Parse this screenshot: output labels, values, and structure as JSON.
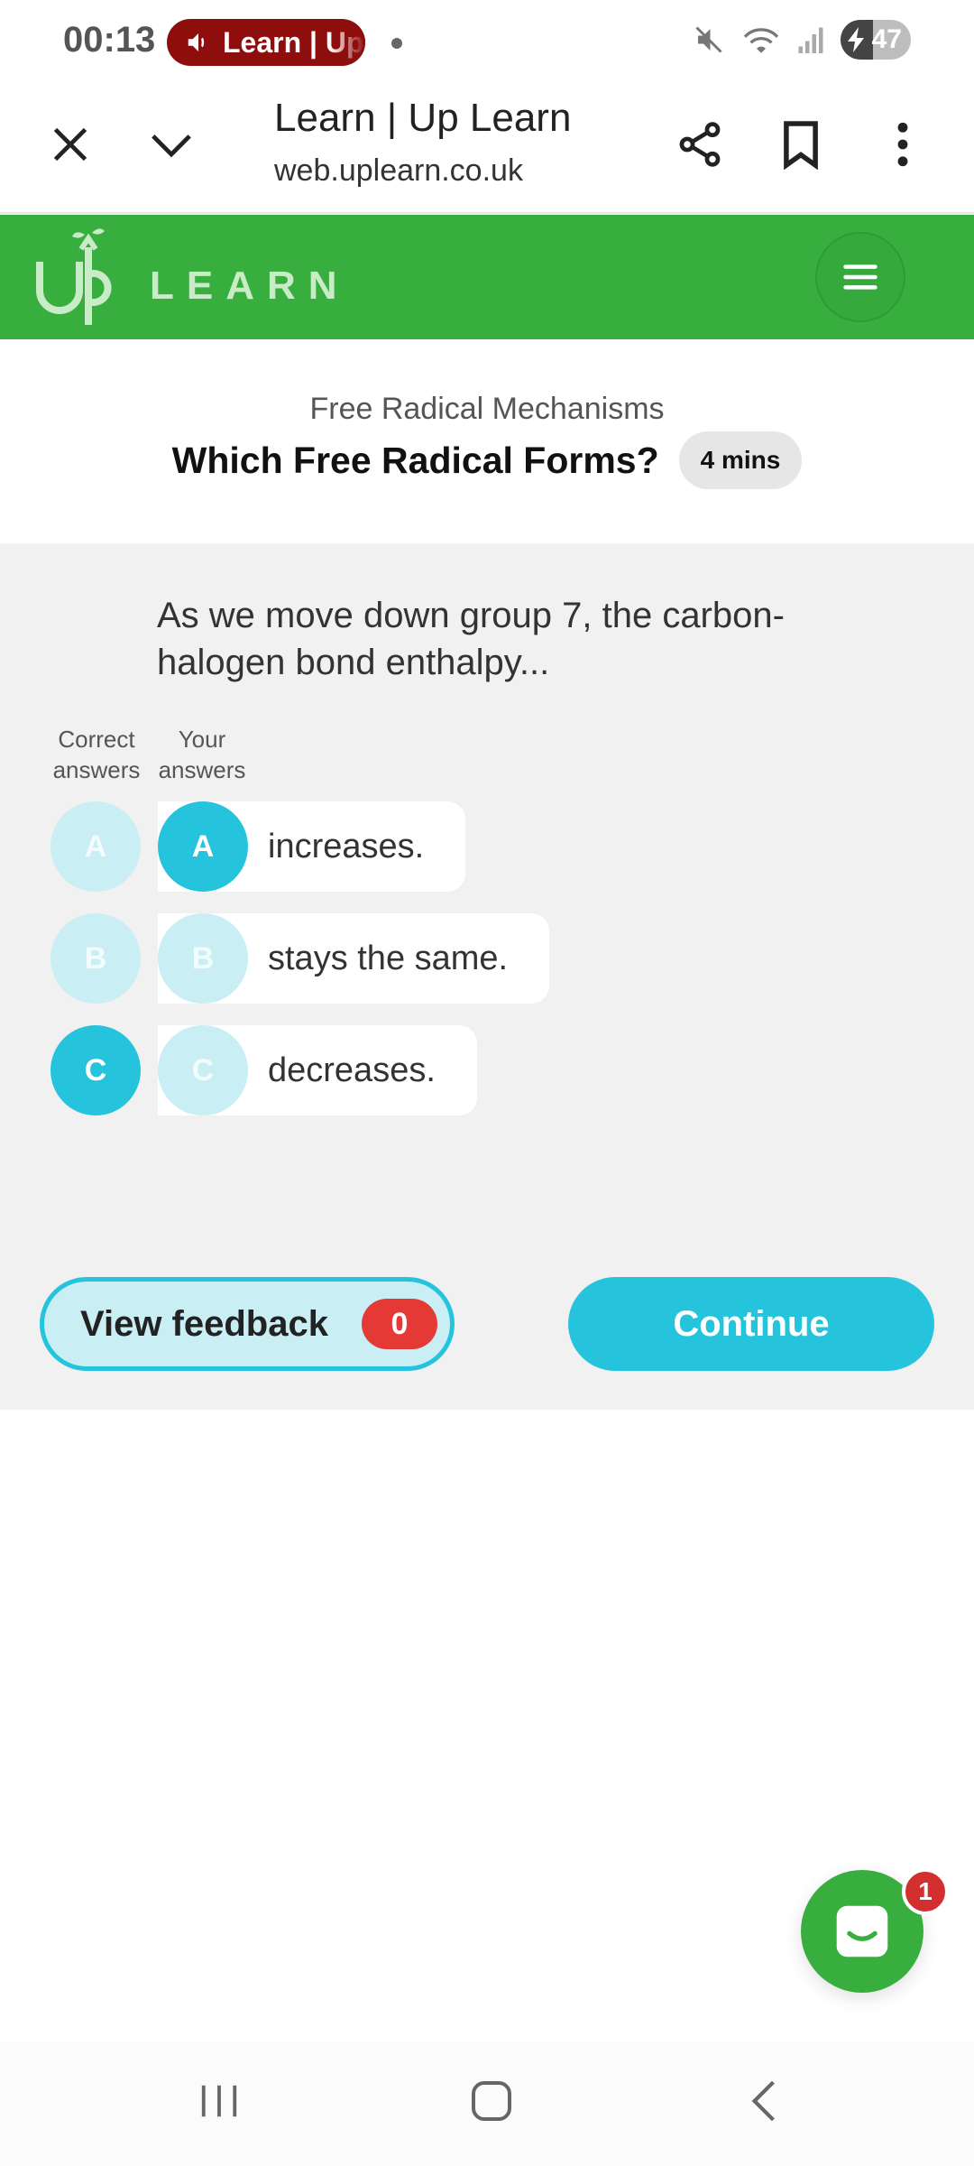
{
  "status_bar": {
    "time": "00:13",
    "media_label": "Learn | Up",
    "battery_level": "47"
  },
  "browser": {
    "title": "Learn | Up Learn",
    "url": "web.uplearn.co.uk"
  },
  "app": {
    "brand_word": "LEARN",
    "brand_color": "#38ae3f"
  },
  "lesson": {
    "topic": "Free Radical Mechanisms",
    "title": "Which Free Radical Forms?",
    "duration": "4 mins"
  },
  "question": {
    "text": "As we move down group 7, the carbon-halogen bond enthalpy...",
    "columns": {
      "correct": "Correct answers",
      "yours": "Your answers"
    },
    "options": [
      {
        "letter": "A",
        "text": "increases.",
        "is_correct": false,
        "selected": true
      },
      {
        "letter": "B",
        "text": "stays the same.",
        "is_correct": false,
        "selected": false
      },
      {
        "letter": "C",
        "text": "decreases.",
        "is_correct": true,
        "selected": false
      }
    ]
  },
  "actions": {
    "feedback_label": "View feedback",
    "feedback_count": "0",
    "continue_label": "Continue"
  },
  "chat": {
    "badge_count": "1"
  },
  "colors": {
    "accent": "#26c4dc",
    "accent_light": "#c9eef3",
    "panel": "#f1f1f1",
    "badge_red": "#e53935"
  }
}
